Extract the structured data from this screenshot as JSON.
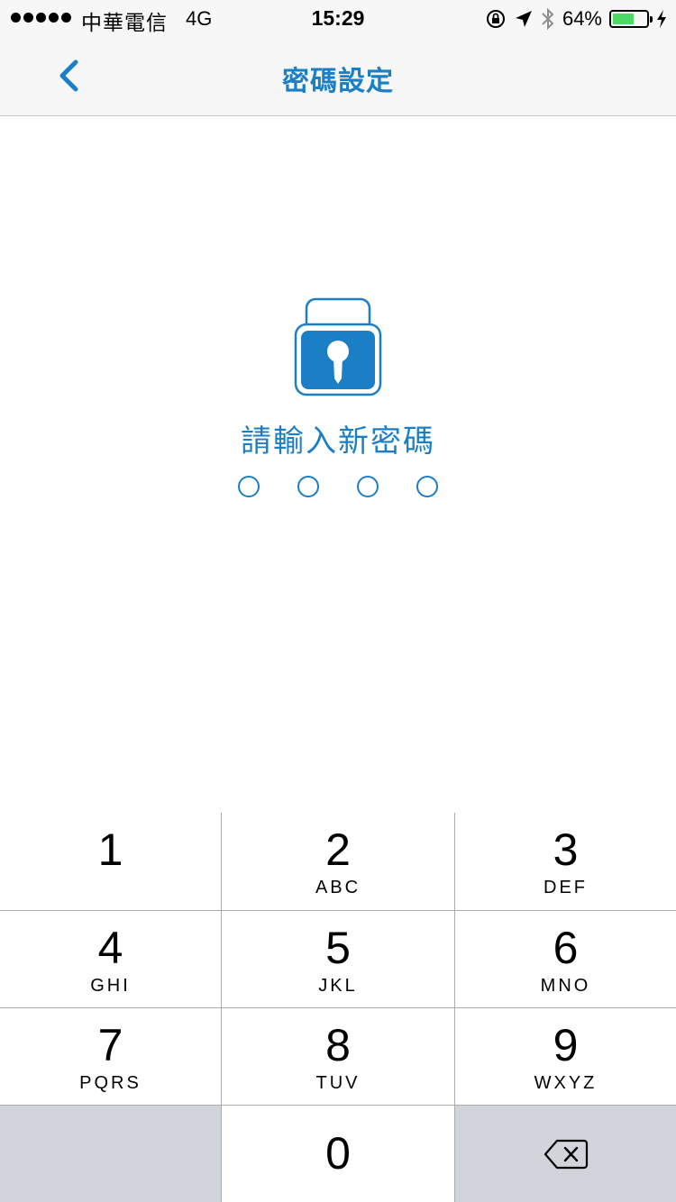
{
  "status_bar": {
    "carrier": "中華電信",
    "network": "4G",
    "time": "15:29",
    "battery": "64%",
    "battery_level": 0.64
  },
  "nav": {
    "title": "密碼設定",
    "accent_color": "#1b7fc6"
  },
  "content": {
    "prompt": "請輸入新密碼",
    "pin_length": 4
  },
  "keypad": {
    "keys": [
      {
        "digit": "1",
        "letters": ""
      },
      {
        "digit": "2",
        "letters": "ABC"
      },
      {
        "digit": "3",
        "letters": "DEF"
      },
      {
        "digit": "4",
        "letters": "GHI"
      },
      {
        "digit": "5",
        "letters": "JKL"
      },
      {
        "digit": "6",
        "letters": "MNO"
      },
      {
        "digit": "7",
        "letters": "PQRS"
      },
      {
        "digit": "8",
        "letters": "TUV"
      },
      {
        "digit": "9",
        "letters": "WXYZ"
      },
      {
        "digit": "0",
        "letters": ""
      }
    ]
  }
}
